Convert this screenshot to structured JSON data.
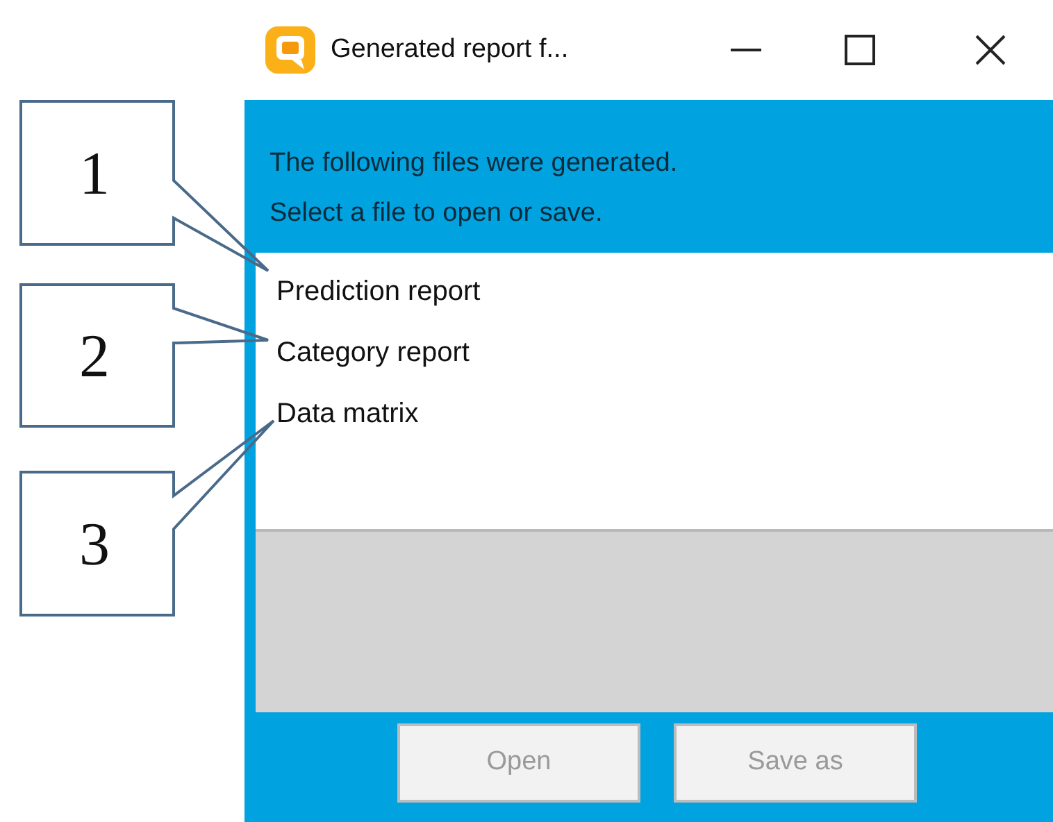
{
  "window": {
    "title": "Generated report f..."
  },
  "message": [
    "The following files were generated.",
    "Select a file to open or save."
  ],
  "files": [
    {
      "name": "Prediction report",
      "selected": false
    },
    {
      "name": "Category report",
      "selected": false
    },
    {
      "name": "Data matrix",
      "selected": false
    }
  ],
  "buttons": [
    {
      "label": "Open",
      "disabled": true
    },
    {
      "label": "Save as",
      "disabled": true
    }
  ],
  "callouts": [
    {
      "number": "1"
    },
    {
      "number": "2"
    },
    {
      "number": "3"
    }
  ]
}
